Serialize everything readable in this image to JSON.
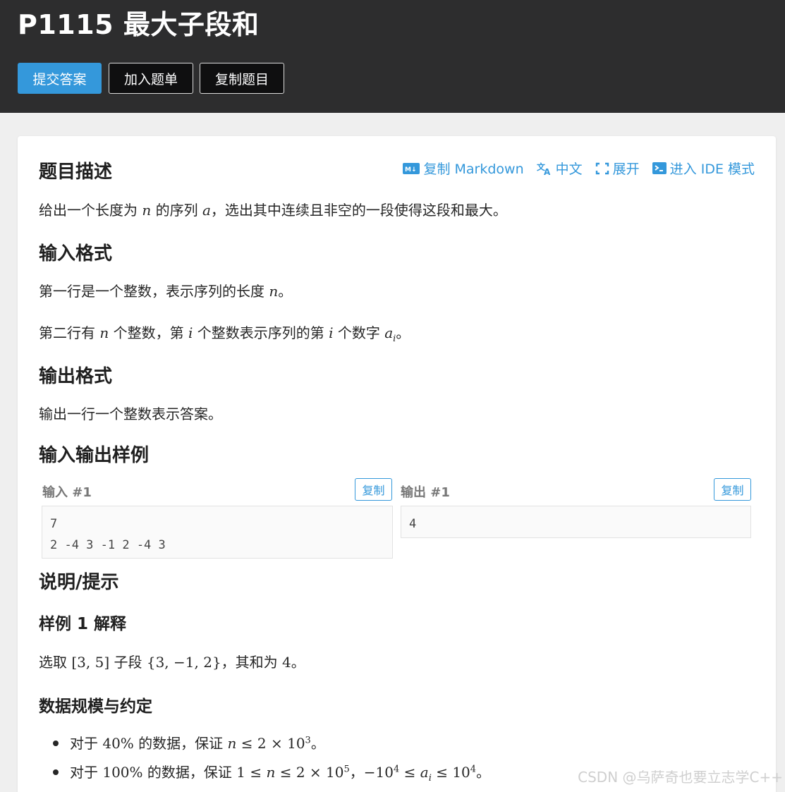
{
  "header": {
    "title": "P1115 最大子段和",
    "buttons": {
      "submit": "提交答案",
      "add_list": "加入题单",
      "copy_problem": "复制题目"
    }
  },
  "toolbar": {
    "copy_markdown": "复制 Markdown",
    "language": "中文",
    "expand": "展开",
    "ide": "进入 IDE 模式"
  },
  "description": {
    "heading": "题目描述",
    "t1": "给出一个长度为",
    "n": "n",
    "t2": "的序列",
    "a": "a",
    "t3": "，选出其中连续且非空的一段使得这段和最大。"
  },
  "input_format": {
    "heading": "输入格式",
    "l1_text": "第一行是一个整数，表示序列的长度",
    "l1_n": "n",
    "l1_end": "。",
    "l2_a": "第二行有",
    "l2_n": "n",
    "l2_b": "个整数，第",
    "l2_i": "i",
    "l2_c": "个整数表示序列的第",
    "l2_i2": "i",
    "l2_d": "个数字",
    "l2_ai": "a",
    "l2_sub": "i",
    "l2_end": "。"
  },
  "output_format": {
    "heading": "输出格式",
    "text": "输出一行一个整数表示答案。"
  },
  "samples": {
    "heading": "输入输出样例",
    "input_label": "输入 #1",
    "output_label": "输出 #1",
    "copy": "复制",
    "input": "7\n2 -4 3 -1 2 -4 3",
    "output": "4"
  },
  "hint": {
    "heading": "说明/提示",
    "sub1": "样例 1 解释",
    "ex_a": "选取",
    "ex_range": "[3, 5]",
    "ex_b": "子段",
    "ex_set": "{3, −1, 2}",
    "ex_c": "，其和为",
    "ex_sum": "4",
    "ex_end": "。",
    "sub2": "数据规模与约定",
    "b1_a": "对于",
    "b1_pct": "40%",
    "b1_b": "的数据，保证",
    "b1_n": "n",
    "b1_rel": " ≤ 2 × 10",
    "b1_exp": "3",
    "b1_end": "。",
    "b2_a": "对于",
    "b2_pct": "100%",
    "b2_b": "的数据，保证",
    "b2_c": "1 ≤ ",
    "b2_n": "n",
    "b2_rel": " ≤ 2 × 10",
    "b2_exp": "5",
    "b2_comma": "，",
    "b2_neg": "−10",
    "b2_exp2": "4",
    "b2_le": " ≤ ",
    "b2_ai": "a",
    "b2_sub": "i",
    "b2_le2": " ≤ 10",
    "b2_exp3": "4",
    "b2_end": "。"
  },
  "watermark": "CSDN @乌萨奇也要立志学C++",
  "colors": {
    "accent": "#3498db",
    "header_bg": "#2d2d2e"
  }
}
